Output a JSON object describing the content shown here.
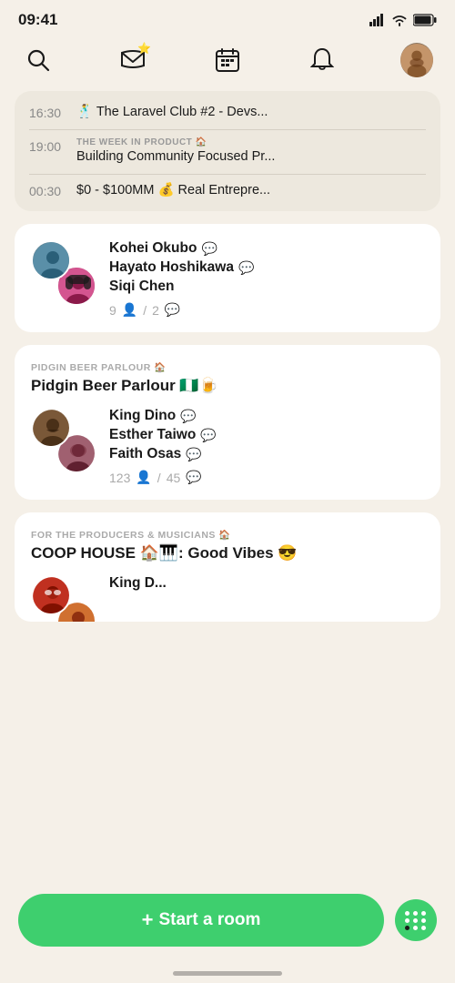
{
  "status": {
    "time": "09:41"
  },
  "nav": {
    "search_label": "search",
    "inbox_label": "inbox",
    "calendar_label": "calendar",
    "bell_label": "notifications",
    "avatar_label": "user avatar"
  },
  "scheduled": {
    "rooms": [
      {
        "time": "16:30",
        "label": "",
        "title": "🕺 The Laravel Club #2 - Devs..."
      },
      {
        "time": "19:00",
        "label": "THE WEEK IN PRODUCT 🏠",
        "title": "Building Community Focused Pr..."
      },
      {
        "time": "00:30",
        "label": "",
        "title": "$0 - $100MM 💰 Real Entrepre..."
      }
    ]
  },
  "rooms": [
    {
      "id": "room1",
      "header": "",
      "title": "",
      "speakers": [
        {
          "name": "Kohei Okubo",
          "avatar_class": "av-kohei"
        },
        {
          "name": "Hayato Hoshikawa",
          "avatar_class": "av-hayato"
        },
        {
          "name": "Siqi Chen",
          "avatar_class": "av-kohei"
        }
      ],
      "listener_count": "9",
      "comment_count": "2"
    },
    {
      "id": "room2",
      "header": "PIDGIN BEER PARLOUR 🏠",
      "title": "Pidgin Beer Parlour 🇳🇬🍺",
      "speakers": [
        {
          "name": "King Dino",
          "avatar_class": "av-king"
        },
        {
          "name": "Esther Taiwo",
          "avatar_class": "av-esther"
        },
        {
          "name": "Faith Osas",
          "avatar_class": "av-king"
        }
      ],
      "listener_count": "123",
      "comment_count": "45"
    },
    {
      "id": "room3",
      "header": "FOR THE PRODUCERS & MUSICIANS 🏠",
      "title": "COOP HOUSE 🏠🎹: Good Vibes 😎",
      "speakers": [
        {
          "name": "King D...",
          "avatar_class": "av-spidey"
        },
        {
          "name": "",
          "avatar_class": "av-producer"
        }
      ],
      "listener_count": "",
      "comment_count": ""
    }
  ],
  "bottom": {
    "start_room_label": "+ Start a room"
  }
}
